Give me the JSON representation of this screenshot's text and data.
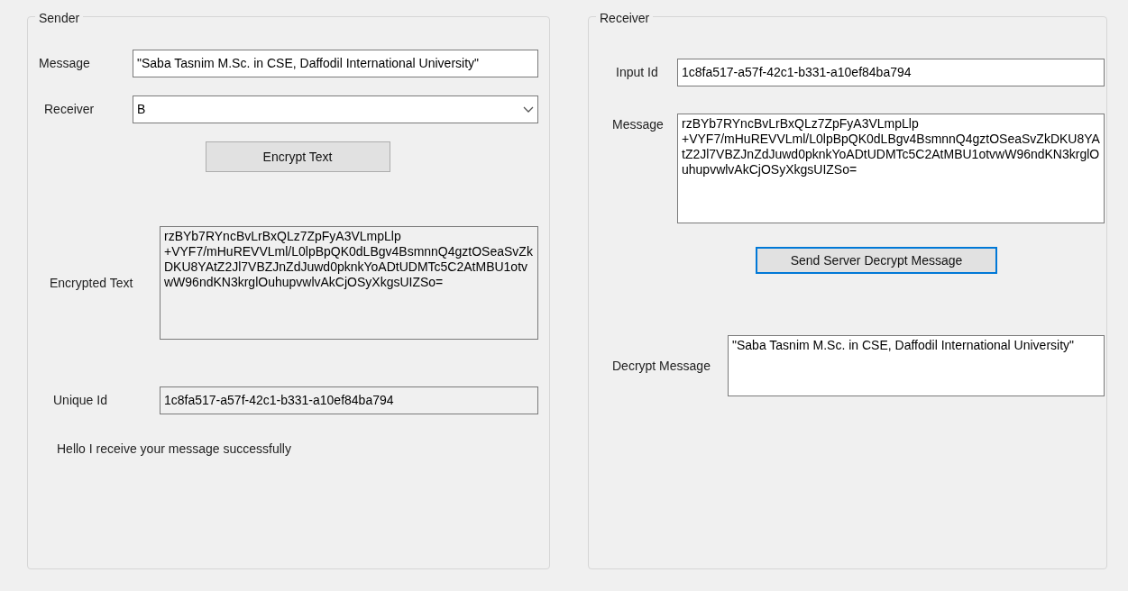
{
  "sender": {
    "title": "Sender",
    "message": {
      "label": "Message",
      "value": "\"Saba Tasnim M.Sc. in CSE, Daffodil International University\"",
      "read_only": false
    },
    "receiver": {
      "label": "Receiver",
      "value": "B"
    },
    "encrypt_button": {
      "label": "Encrypt Text",
      "focused": false
    },
    "encrypted_text": {
      "label": "Encrypted Text",
      "value": "rzBYb7RYncBvLrBxQLz7ZpFyA3VLmpLlp +VYF7/mHuREVVLml/L0lpBpQK0dLBgv4BsmnnQ4gztOSeaSvZkDKU8YAtZ2Jl7VBZJnZdJuwd0pknkYoADtUDMTc5C2AtMBU1otvwW96ndKN3krglOuhupvwlvAkCjOSyXkgsUIZSo=",
      "read_only": true
    },
    "unique_id": {
      "label": "Unique Id",
      "value": "1c8fa517-a57f-42c1-b331-a10ef84ba794",
      "read_only": true
    },
    "status": "Hello I receive your message successfully"
  },
  "receiver": {
    "title": "Receiver",
    "input_id": {
      "label": "Input Id",
      "value": "1c8fa517-a57f-42c1-b331-a10ef84ba794",
      "read_only": false
    },
    "message": {
      "label": "Message",
      "value": "rzBYb7RYncBvLrBxQLz7ZpFyA3VLmpLlp +VYF7/mHuREVVLml/L0lpBpQK0dLBgv4BsmnnQ4gztOSeaSvZkDKU8YAtZ2Jl7VBZJnZdJuwd0pknkYoADtUDMTc5C2AtMBU1otvwW96ndKN3krglOuhupvwlvAkCjOSyXkgsUIZSo=",
      "read_only": false
    },
    "decrypt_button": {
      "label": "Send Server Decrypt Message",
      "focused": true
    },
    "decrypt_message": {
      "label": "Decrypt Message",
      "value": "\"Saba Tasnim M.Sc. in CSE, Daffodil International University\"",
      "read_only": false
    }
  }
}
